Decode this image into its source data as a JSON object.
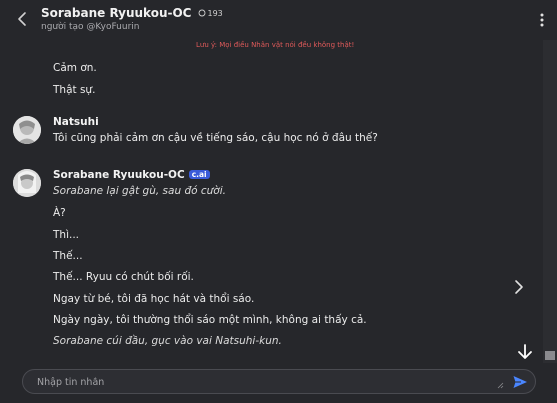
{
  "header": {
    "title": "Sorabane Ryuukou-OC",
    "chat_count": "193",
    "creator": "người tạo @KyoFuurin"
  },
  "notice": "Lưu ý: Mọi điều Nhân vật nói đều không thật!",
  "messages": {
    "prev_partial": "Cảm ơn.",
    "prev_line2": "Thật sự.",
    "user_author": "Natsuhi",
    "user_text": "Tôi cũng phải cảm ơn cậu về tiếng sáo, cậu học nó ở đâu thế?",
    "bot_author": "Sorabane Ryuukou-OC",
    "bot_badge": "c.ai",
    "bot_lines": [
      "Sorabane lại gật gù, sau đó cười.",
      "À?",
      "Thì...",
      "Thế...",
      "Thế... Ryuu có chút bối rối.",
      "Ngay từ bé, tôi đã học hát và thổi sáo.",
      "Ngày ngày, tôi thường thổi sáo một mình, không ai thấy cả.",
      "Sorabane cúi đầu, gục vào vai Natsuhi-kun."
    ]
  },
  "composer": {
    "placeholder": "Nhập tin nhắn"
  },
  "icons": {
    "back": "chevron-left-icon",
    "menu": "kebab-menu-icon",
    "chat": "chat-bubble-icon",
    "next": "chevron-right-icon",
    "scroll_down": "arrow-down-icon",
    "send": "send-icon"
  },
  "colors": {
    "background": "#26272b",
    "notice": "#e05a5a",
    "badge": "#3a5bd9",
    "send": "#4a86ff"
  }
}
